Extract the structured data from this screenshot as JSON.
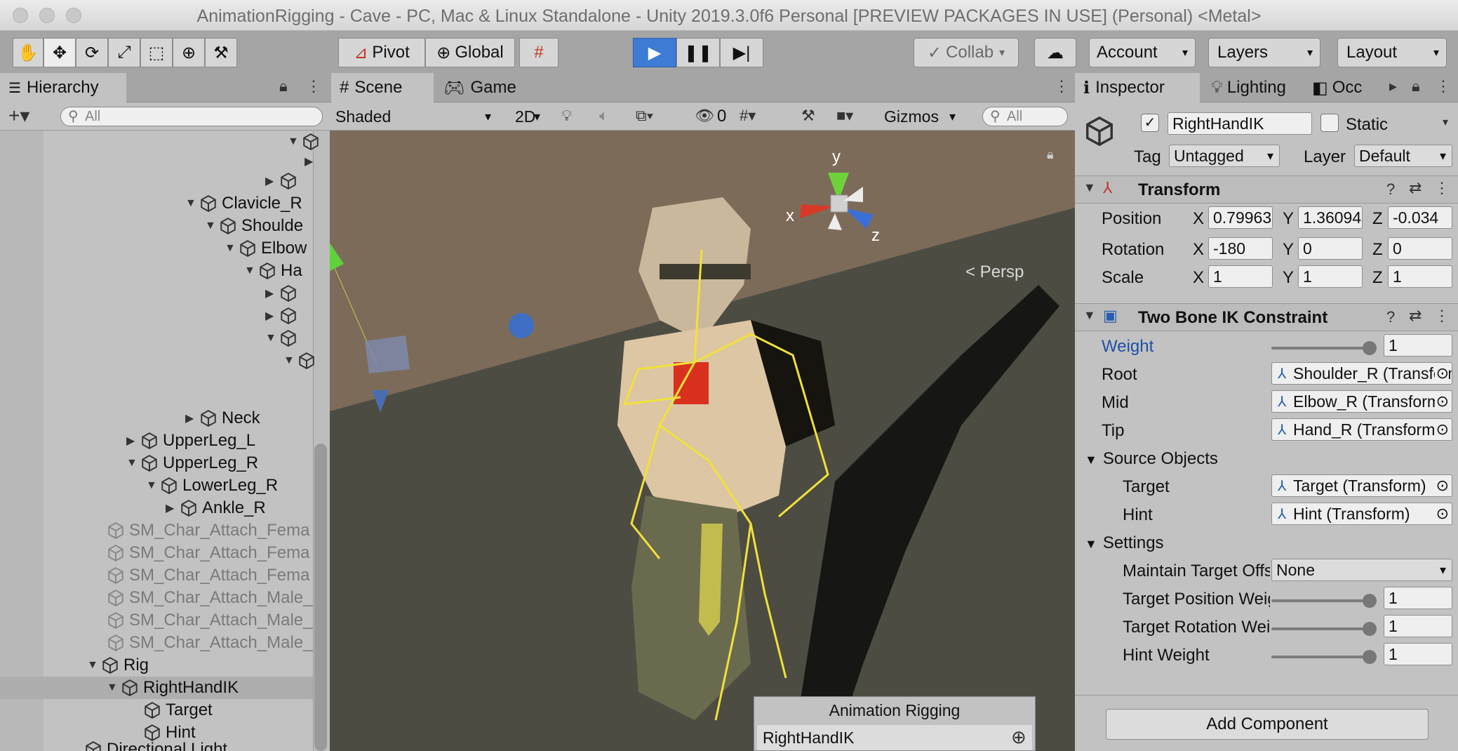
{
  "window": {
    "title": "AnimationRigging - Cave - PC, Mac & Linux Standalone - Unity 2019.3.0f6 Personal [PREVIEW PACKAGES IN USE] (Personal) <Metal>"
  },
  "toolbar": {
    "pivot_label": "Pivot",
    "global_label": "Global",
    "collab_label": "Collab",
    "account_label": "Account",
    "layers_label": "Layers",
    "layout_label": "Layout"
  },
  "hierarchy": {
    "tab_label": "Hierarchy",
    "search_placeholder": "All",
    "rows": [
      {
        "label": "Clavicle_R"
      },
      {
        "label": "Shoulde"
      },
      {
        "label": "Elbow"
      },
      {
        "label": "Ha"
      },
      {
        "label": "Neck"
      },
      {
        "label": "UpperLeg_L"
      },
      {
        "label": "UpperLeg_R"
      },
      {
        "label": "LowerLeg_R"
      },
      {
        "label": "Ankle_R"
      },
      {
        "label": "SM_Char_Attach_Fema"
      },
      {
        "label": "SM_Char_Attach_Fema"
      },
      {
        "label": "SM_Char_Attach_Fema"
      },
      {
        "label": "SM_Char_Attach_Male_"
      },
      {
        "label": "SM_Char_Attach_Male_"
      },
      {
        "label": "SM_Char_Attach_Male_"
      },
      {
        "label": "Rig"
      },
      {
        "label": "RightHandIK"
      },
      {
        "label": "Target"
      },
      {
        "label": "Hint"
      },
      {
        "label": "Directional Light"
      }
    ]
  },
  "scene": {
    "tab_scene": "Scene",
    "tab_game": "Game",
    "shading_mode": "Shaded",
    "mode_2d": "2D",
    "hidden_count": "0",
    "gizmos_label": "Gizmos",
    "search_placeholder": "All",
    "persp_label": "< Persp",
    "axis_x": "x",
    "axis_y": "y",
    "axis_z": "z",
    "overlay_title": "Animation Rigging",
    "overlay_item": "RightHandIK"
  },
  "inspector": {
    "tab_inspector": "Inspector",
    "tab_lighting": "Lighting",
    "tab_occ": "Occ",
    "object_name": "RightHandIK",
    "static_label": "Static",
    "tag_label": "Tag",
    "tag_value": "Untagged",
    "layer_label": "Layer",
    "layer_value": "Default",
    "transform": {
      "title": "Transform",
      "position_label": "Position",
      "rotation_label": "Rotation",
      "scale_label": "Scale",
      "x": "X",
      "y": "Y",
      "z": "Z",
      "position": [
        "0.79963",
        "1.36094",
        "-0.034"
      ],
      "rotation": [
        "-180",
        "0",
        "0"
      ],
      "scale": [
        "1",
        "1",
        "1"
      ]
    },
    "ik": {
      "title": "Two Bone IK Constraint",
      "weight_label": "Weight",
      "weight_value": "1",
      "root_label": "Root",
      "root_value": "Shoulder_R (Transform)",
      "mid_label": "Mid",
      "mid_value": "Elbow_R (Transform)",
      "tip_label": "Tip",
      "tip_value": "Hand_R (Transform)",
      "source_objects_label": "Source Objects",
      "target_label": "Target",
      "target_value": "Target (Transform)",
      "hint_label": "Hint",
      "hint_value": "Hint (Transform)",
      "settings_label": "Settings",
      "maintain_label": "Maintain Target Offset",
      "maintain_value": "None",
      "target_pos_label": "Target Position Weight",
      "target_pos_value": "1",
      "target_rot_label": "Target Rotation Weight",
      "target_rot_value": "1",
      "hint_weight_label": "Hint Weight",
      "hint_weight_value": "1"
    },
    "add_component_label": "Add Component"
  }
}
